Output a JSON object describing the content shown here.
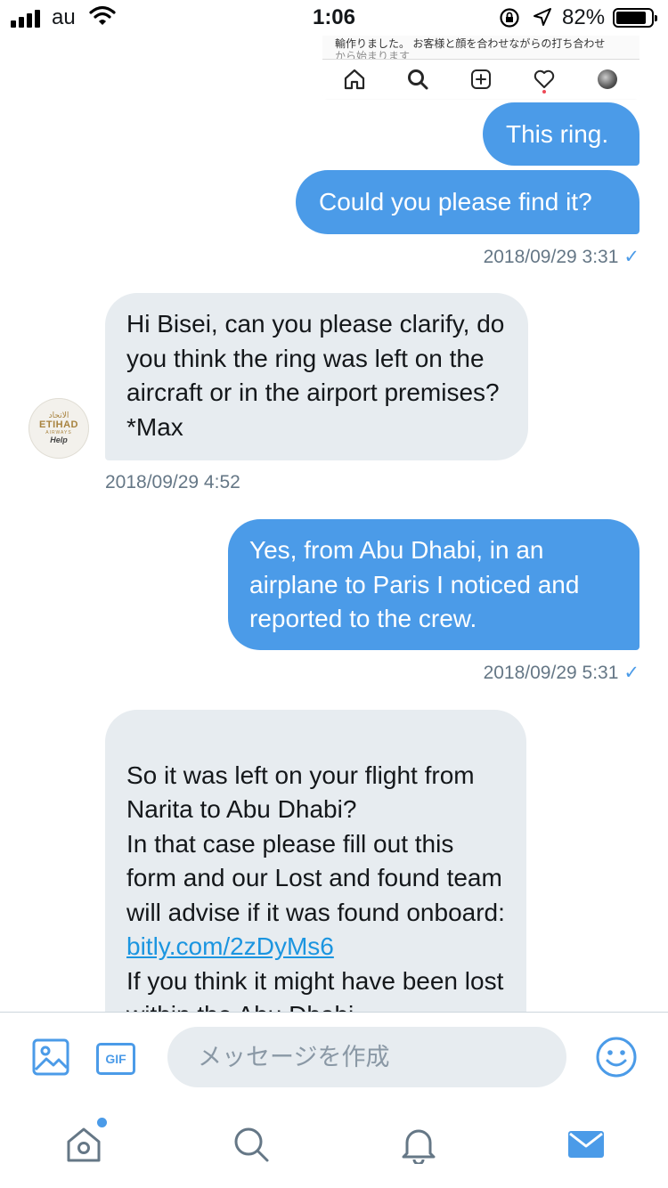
{
  "status_bar": {
    "carrier": "au",
    "time": "1:06",
    "battery": "82%"
  },
  "shared_image": {
    "line1": "輸作りました。 お客様と顔を合わせながらの打ち合わせ",
    "line2": "から始まります"
  },
  "messages": [
    {
      "dir": "out",
      "text": "This ring."
    },
    {
      "dir": "out",
      "text": "Could you please find it?",
      "time": "2018/09/29 3:31"
    },
    {
      "dir": "in",
      "text": "Hi Bisei, can you please clarify, do you think the ring was left on the aircraft or in the airport premises? *Max",
      "time": "2018/09/29 4:52"
    },
    {
      "dir": "out",
      "text": "Yes, from Abu Dhabi, in an airplane to Paris I noticed and reported to the crew.",
      "time": "2018/09/29 5:31"
    },
    {
      "dir": "in",
      "text_before": "So it was left on your flight from Narita to Abu Dhabi?\nIn that case please fill out this form and our Lost and found team will advise if it was found onboard: ",
      "link": "bitly.com/2zDyMs6",
      "text_after": "\nIf you think it might have been lost within the Abu Dhabi"
    }
  ],
  "sender_avatar": {
    "arabic": "الاتحاد",
    "brand": "ETIHAD",
    "sub": "AIRWAYS",
    "label": "Help"
  },
  "composer": {
    "placeholder": "メッセージを作成",
    "gif_label": "GIF"
  },
  "colors": {
    "accent": "#4b9be8",
    "incoming_bubble": "#e7ecf0",
    "meta_text": "#657786"
  },
  "icons": [
    "image-icon",
    "gif-icon",
    "emoji-icon",
    "home-icon",
    "search-icon",
    "bell-icon",
    "mail-icon"
  ]
}
